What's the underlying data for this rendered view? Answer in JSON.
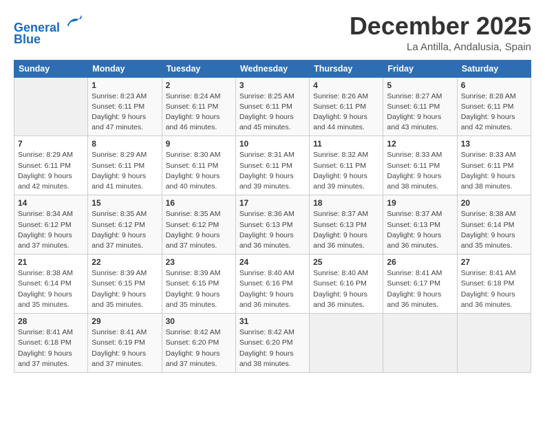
{
  "header": {
    "logo_line1": "General",
    "logo_line2": "Blue",
    "month": "December 2025",
    "location": "La Antilla, Andalusia, Spain"
  },
  "weekdays": [
    "Sunday",
    "Monday",
    "Tuesday",
    "Wednesday",
    "Thursday",
    "Friday",
    "Saturday"
  ],
  "weeks": [
    [
      {
        "day": "",
        "sunrise": "",
        "sunset": "",
        "daylight": ""
      },
      {
        "day": "1",
        "sunrise": "Sunrise: 8:23 AM",
        "sunset": "Sunset: 6:11 PM",
        "daylight": "Daylight: 9 hours and 47 minutes."
      },
      {
        "day": "2",
        "sunrise": "Sunrise: 8:24 AM",
        "sunset": "Sunset: 6:11 PM",
        "daylight": "Daylight: 9 hours and 46 minutes."
      },
      {
        "day": "3",
        "sunrise": "Sunrise: 8:25 AM",
        "sunset": "Sunset: 6:11 PM",
        "daylight": "Daylight: 9 hours and 45 minutes."
      },
      {
        "day": "4",
        "sunrise": "Sunrise: 8:26 AM",
        "sunset": "Sunset: 6:11 PM",
        "daylight": "Daylight: 9 hours and 44 minutes."
      },
      {
        "day": "5",
        "sunrise": "Sunrise: 8:27 AM",
        "sunset": "Sunset: 6:11 PM",
        "daylight": "Daylight: 9 hours and 43 minutes."
      },
      {
        "day": "6",
        "sunrise": "Sunrise: 8:28 AM",
        "sunset": "Sunset: 6:11 PM",
        "daylight": "Daylight: 9 hours and 42 minutes."
      }
    ],
    [
      {
        "day": "7",
        "sunrise": "Sunrise: 8:29 AM",
        "sunset": "Sunset: 6:11 PM",
        "daylight": "Daylight: 9 hours and 42 minutes."
      },
      {
        "day": "8",
        "sunrise": "Sunrise: 8:29 AM",
        "sunset": "Sunset: 6:11 PM",
        "daylight": "Daylight: 9 hours and 41 minutes."
      },
      {
        "day": "9",
        "sunrise": "Sunrise: 8:30 AM",
        "sunset": "Sunset: 6:11 PM",
        "daylight": "Daylight: 9 hours and 40 minutes."
      },
      {
        "day": "10",
        "sunrise": "Sunrise: 8:31 AM",
        "sunset": "Sunset: 6:11 PM",
        "daylight": "Daylight: 9 hours and 39 minutes."
      },
      {
        "day": "11",
        "sunrise": "Sunrise: 8:32 AM",
        "sunset": "Sunset: 6:11 PM",
        "daylight": "Daylight: 9 hours and 39 minutes."
      },
      {
        "day": "12",
        "sunrise": "Sunrise: 8:33 AM",
        "sunset": "Sunset: 6:11 PM",
        "daylight": "Daylight: 9 hours and 38 minutes."
      },
      {
        "day": "13",
        "sunrise": "Sunrise: 8:33 AM",
        "sunset": "Sunset: 6:11 PM",
        "daylight": "Daylight: 9 hours and 38 minutes."
      }
    ],
    [
      {
        "day": "14",
        "sunrise": "Sunrise: 8:34 AM",
        "sunset": "Sunset: 6:12 PM",
        "daylight": "Daylight: 9 hours and 37 minutes."
      },
      {
        "day": "15",
        "sunrise": "Sunrise: 8:35 AM",
        "sunset": "Sunset: 6:12 PM",
        "daylight": "Daylight: 9 hours and 37 minutes."
      },
      {
        "day": "16",
        "sunrise": "Sunrise: 8:35 AM",
        "sunset": "Sunset: 6:12 PM",
        "daylight": "Daylight: 9 hours and 37 minutes."
      },
      {
        "day": "17",
        "sunrise": "Sunrise: 8:36 AM",
        "sunset": "Sunset: 6:13 PM",
        "daylight": "Daylight: 9 hours and 36 minutes."
      },
      {
        "day": "18",
        "sunrise": "Sunrise: 8:37 AM",
        "sunset": "Sunset: 6:13 PM",
        "daylight": "Daylight: 9 hours and 36 minutes."
      },
      {
        "day": "19",
        "sunrise": "Sunrise: 8:37 AM",
        "sunset": "Sunset: 6:13 PM",
        "daylight": "Daylight: 9 hours and 36 minutes."
      },
      {
        "day": "20",
        "sunrise": "Sunrise: 8:38 AM",
        "sunset": "Sunset: 6:14 PM",
        "daylight": "Daylight: 9 hours and 35 minutes."
      }
    ],
    [
      {
        "day": "21",
        "sunrise": "Sunrise: 8:38 AM",
        "sunset": "Sunset: 6:14 PM",
        "daylight": "Daylight: 9 hours and 35 minutes."
      },
      {
        "day": "22",
        "sunrise": "Sunrise: 8:39 AM",
        "sunset": "Sunset: 6:15 PM",
        "daylight": "Daylight: 9 hours and 35 minutes."
      },
      {
        "day": "23",
        "sunrise": "Sunrise: 8:39 AM",
        "sunset": "Sunset: 6:15 PM",
        "daylight": "Daylight: 9 hours and 35 minutes."
      },
      {
        "day": "24",
        "sunrise": "Sunrise: 8:40 AM",
        "sunset": "Sunset: 6:16 PM",
        "daylight": "Daylight: 9 hours and 36 minutes."
      },
      {
        "day": "25",
        "sunrise": "Sunrise: 8:40 AM",
        "sunset": "Sunset: 6:16 PM",
        "daylight": "Daylight: 9 hours and 36 minutes."
      },
      {
        "day": "26",
        "sunrise": "Sunrise: 8:41 AM",
        "sunset": "Sunset: 6:17 PM",
        "daylight": "Daylight: 9 hours and 36 minutes."
      },
      {
        "day": "27",
        "sunrise": "Sunrise: 8:41 AM",
        "sunset": "Sunset: 6:18 PM",
        "daylight": "Daylight: 9 hours and 36 minutes."
      }
    ],
    [
      {
        "day": "28",
        "sunrise": "Sunrise: 8:41 AM",
        "sunset": "Sunset: 6:18 PM",
        "daylight": "Daylight: 9 hours and 37 minutes."
      },
      {
        "day": "29",
        "sunrise": "Sunrise: 8:41 AM",
        "sunset": "Sunset: 6:19 PM",
        "daylight": "Daylight: 9 hours and 37 minutes."
      },
      {
        "day": "30",
        "sunrise": "Sunrise: 8:42 AM",
        "sunset": "Sunset: 6:20 PM",
        "daylight": "Daylight: 9 hours and 37 minutes."
      },
      {
        "day": "31",
        "sunrise": "Sunrise: 8:42 AM",
        "sunset": "Sunset: 6:20 PM",
        "daylight": "Daylight: 9 hours and 38 minutes."
      },
      {
        "day": "",
        "sunrise": "",
        "sunset": "",
        "daylight": ""
      },
      {
        "day": "",
        "sunrise": "",
        "sunset": "",
        "daylight": ""
      },
      {
        "day": "",
        "sunrise": "",
        "sunset": "",
        "daylight": ""
      }
    ]
  ]
}
